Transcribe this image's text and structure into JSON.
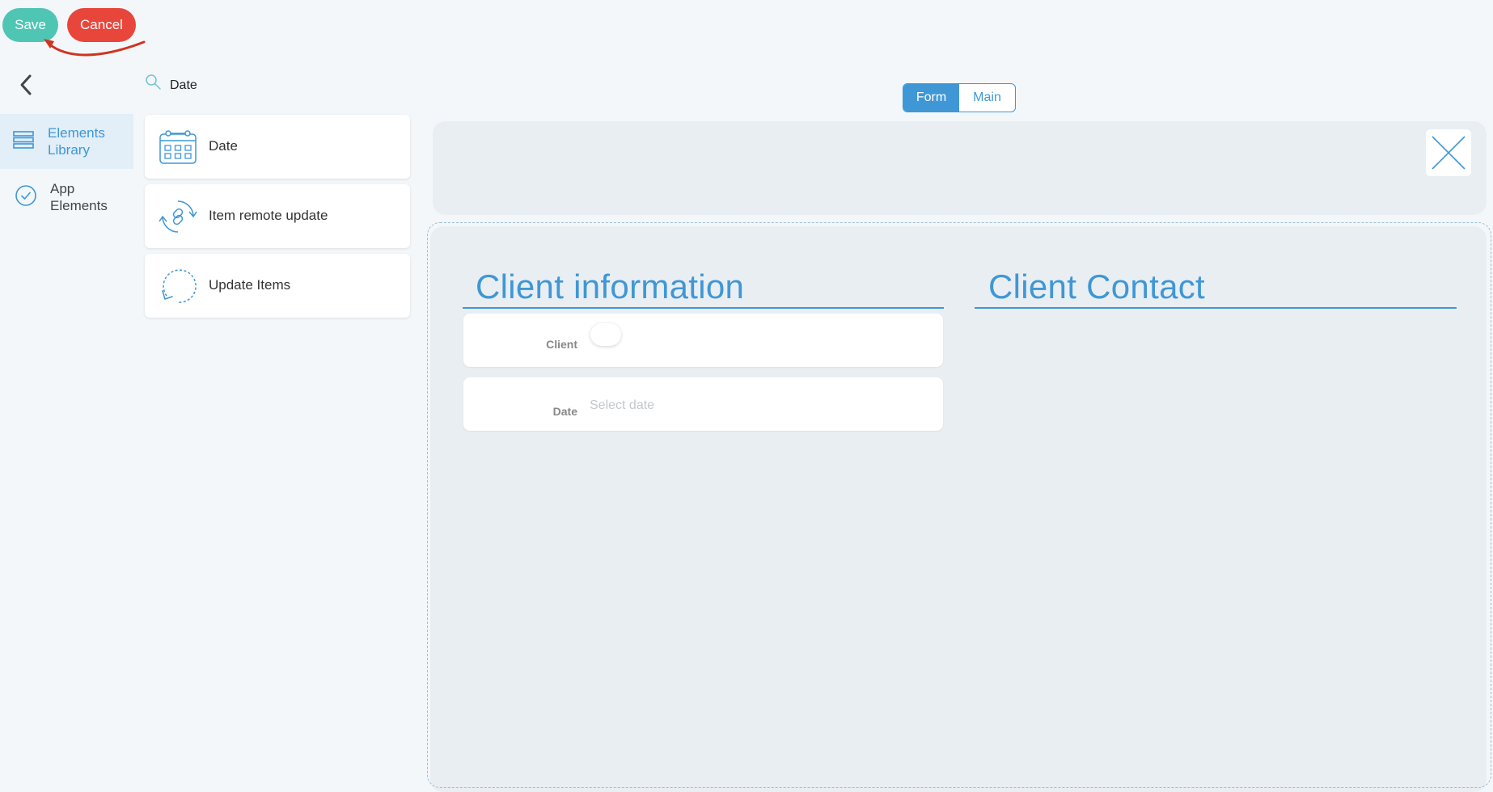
{
  "toolbar": {
    "save_label": "Save",
    "cancel_label": "Cancel"
  },
  "sidebar": {
    "items": [
      {
        "label": "Elements Library",
        "icon": "layers-icon",
        "active": true
      },
      {
        "label": "App Elements",
        "icon": "check-circle-icon",
        "active": false
      }
    ]
  },
  "search": {
    "value": "Date"
  },
  "elements": [
    {
      "label": "Date",
      "icon": "calendar-icon"
    },
    {
      "label": "Item remote update",
      "icon": "link-refresh-icon"
    },
    {
      "label": "Update Items",
      "icon": "refresh-icon"
    }
  ],
  "view_toggle": {
    "options": [
      "Form",
      "Main"
    ],
    "selected": "Form"
  },
  "form": {
    "sections": [
      {
        "title": "Client information"
      },
      {
        "title": "Client Contact"
      }
    ],
    "fields": [
      {
        "label": "Client",
        "type": "toggle"
      },
      {
        "label": "Date",
        "type": "date",
        "placeholder": "Select date"
      }
    ]
  },
  "colors": {
    "accent": "#3f97d6",
    "save": "#4fc6b4",
    "cancel": "#e8463b",
    "annotation_arrow": "#d0341f"
  }
}
